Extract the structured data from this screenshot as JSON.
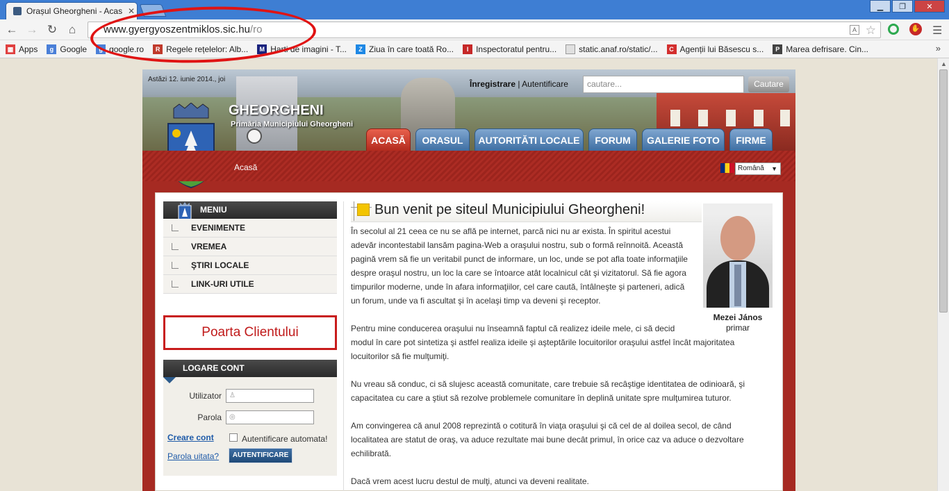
{
  "browser": {
    "tab_title": "Orașul Gheorgheni - Acas",
    "url_host": "www.gyergyoszentmiklos.sic.hu",
    "url_path": "/ro",
    "bookmarks": [
      {
        "label": "Apps",
        "color": "#e04040"
      },
      {
        "label": "Google",
        "color": "#4a7fd8"
      },
      {
        "label": "google.ro",
        "color": "#4a7fd8"
      },
      {
        "label": "Regele rețelelor: Alb...",
        "color": "#c0392b"
      },
      {
        "label": "Harti de imagini - T...",
        "color": "#1a237e"
      },
      {
        "label": "Ziua în care toată Ro...",
        "color": "#1e88e5"
      },
      {
        "label": "Inspectoratul pentru...",
        "color": "#c62828"
      },
      {
        "label": "static.anaf.ro/static/...",
        "color": "#9e9e9e"
      },
      {
        "label": "Agenții lui Băsescu s...",
        "color": "#d32f2f"
      },
      {
        "label": "Marea defrisare. Cin...",
        "color": "#424242"
      }
    ]
  },
  "site": {
    "date": "Astăzi 12. iunie 2014., joi",
    "title": "GHEORGHENI",
    "subtitle": "Primăria Municipiului Gheorgheni",
    "register": "Înregistrare",
    "separator": "|",
    "login": "Autentificare",
    "search_placeholder": "cautare...",
    "search_button": "Cautare",
    "nav": [
      "ACASĂ",
      "ORASUL",
      "AUTORITĂTI LOCALE",
      "FORUM",
      "GALERIE FOTO",
      "FIRME"
    ],
    "breadcrumb": "Acasă",
    "language": "Română"
  },
  "sidebar": {
    "menu_title": "MENIU",
    "items": [
      "EVENIMENTE",
      "VREMEA",
      "ŞTIRI LOCALE",
      "LINK-URI UTILE"
    ],
    "poarta": "Poarta Clientului",
    "login_title": "LOGARE CONT",
    "user_label": "Utilizator",
    "pass_label": "Parola",
    "create_account": "Creare cont",
    "auto_login": "Autentificare automata!",
    "forgot": "Parola uitata?",
    "auth_button": "AUTENTIFICARE"
  },
  "main": {
    "heading": "Bun venit pe siteul Municipiului Gheorgheni!",
    "person_name": "Mezei János",
    "person_role": "primar",
    "p1": [
      "În secolul al 21 ceea ce nu se află pe internet, parcă nici nu ar exista. În spiritul acestui",
      "adevăr incontestabil lansăm pagina-Web a oraşului nostru, sub o formă reînnoită. Această",
      "pagină vrem să fie un veritabil punct de informare, un loc, unde se pot afla toate informaţiile",
      "despre oraşul nostru, un loc la care se întoarce atât localnicul cât şi vizitatorul. Să fie agora",
      "timpurilor moderne, unde în afara informaţiilor, cel care caută, întâlneşte şi parteneri, adică",
      "un forum, unde va fi ascultat şi în acelaşi timp va deveni şi receptor."
    ],
    "p2": [
      "Pentru mine conducerea oraşului nu înseamnă faptul că realizez ideile mele, ci să decid",
      "modul în care pot sintetiza şi astfel realiza ideile şi aşteptările locuitorilor oraşului astfel încât majoritatea",
      "locuitorilor să fie mulţumiţi."
    ],
    "p3": [
      "Nu vreau să conduc, ci să slujesc această comunitate, care trebuie să recâştige identitatea de odinioară, şi",
      "capacitatea cu care a ştiut să rezolve problemele comunitare în deplină unitate spre mulţumirea tuturor."
    ],
    "p4": [
      "Am convingerea că anul 2008 reprezintă o cotitură în viaţa oraşului şi că cel de al doilea secol, de când",
      "localitatea are statut de oraş, va aduce rezultate mai bune decât primul, în orice caz va aduce o dezvoltare",
      "echilibrată."
    ],
    "p5": [
      "Dacă vrem acest lucru destul de mulţi, atunci va deveni realitate."
    ]
  }
}
